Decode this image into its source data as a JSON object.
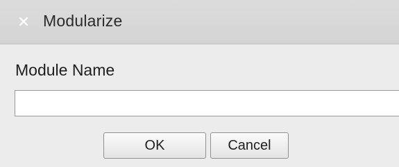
{
  "dialog": {
    "title": "Modularize",
    "close_icon": "close-icon"
  },
  "form": {
    "label": "Module Name",
    "input_value": "",
    "input_placeholder": ""
  },
  "buttons": {
    "ok_label": "OK",
    "cancel_label": "Cancel"
  },
  "colors": {
    "titlebar": "#d8d8d8",
    "body": "#ececec",
    "input_bg": "#ffffff"
  }
}
